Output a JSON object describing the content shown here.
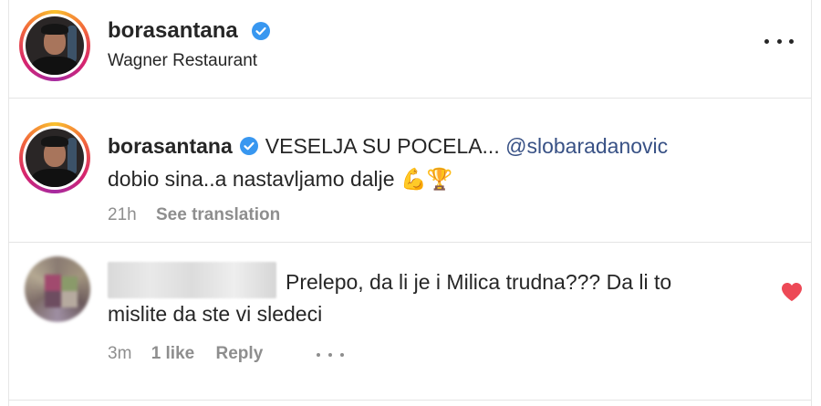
{
  "post_header": {
    "username": "borasantana",
    "location": "Wagner Restaurant",
    "verified_icon": "verified-badge-icon",
    "more_icon": "more-options-icon"
  },
  "caption": {
    "username": "borasantana",
    "text_part1": "VESELJA SU POCELA...",
    "mention": "@slobaradanovic",
    "text_part2": "dobio sina..a nastavljamo dalje",
    "emoji": "💪🏆",
    "time": "21h",
    "see_translation": "See translation"
  },
  "comment": {
    "text_line1": "Prelepo, da li je i Milica trudna??? Da li to",
    "text_line2": "mislite da ste vi sledeci",
    "time": "3m",
    "likes": "1 like",
    "reply": "Reply",
    "liked": true,
    "heart_color": "#ed4956"
  },
  "colors": {
    "mention": "#385185",
    "muted": "#8e8e8e",
    "verified": "#3897f0"
  }
}
